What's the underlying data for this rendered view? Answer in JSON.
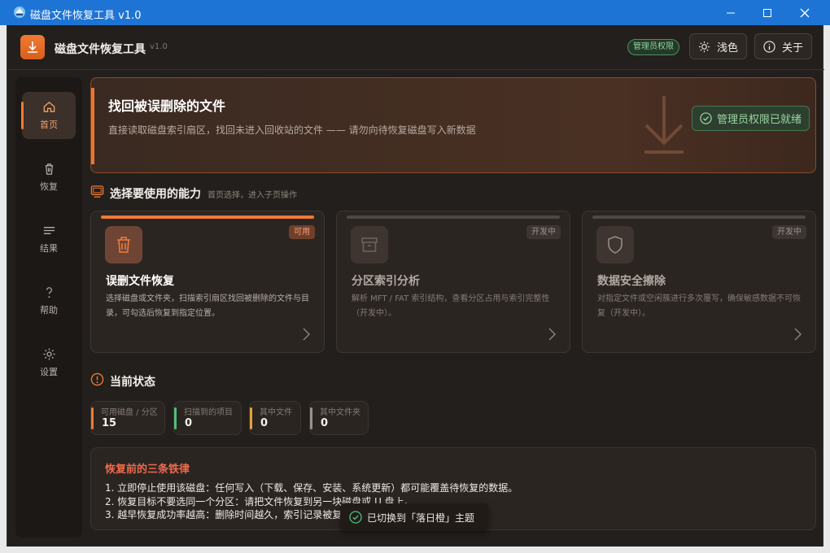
{
  "window": {
    "title": "磁盘文件恢复工具 v1.0"
  },
  "header": {
    "app_name": "磁盘文件恢复工具",
    "version": "v1.0",
    "admin_badge": "管理员权限",
    "theme_label": "浅色",
    "about_label": "关于"
  },
  "sidebar": {
    "items": [
      {
        "label": "首页",
        "icon": "home-icon",
        "active": true
      },
      {
        "label": "恢复",
        "icon": "trash-icon"
      },
      {
        "label": "结果",
        "icon": "list-icon"
      },
      {
        "label": "帮助",
        "icon": "help-icon"
      },
      {
        "label": "设置",
        "icon": "settings-icon"
      }
    ]
  },
  "hero": {
    "title": "找回被误删除的文件",
    "subtitle": "直接读取磁盘索引扇区，找回未进入回收站的文件 —— 请勿向待恢复磁盘写入新数据",
    "status": "管理员权限已就绪"
  },
  "capabilities": {
    "title": "选择要使用的能力",
    "hint": "首页选择，进入子页操作",
    "cards": [
      {
        "title": "误删文件恢复",
        "badge": "可用",
        "desc": "选择磁盘或文件夹，扫描索引扇区找回被删除的文件与目录，可勾选后恢复到指定位置。",
        "icon": "trash-icon"
      },
      {
        "title": "分区索引分析",
        "badge": "开发中",
        "desc": "解析 MFT / FAT 索引结构，查看分区占用与索引完整性（开发中）。",
        "icon": "archive-icon"
      },
      {
        "title": "数据安全擦除",
        "badge": "开发中",
        "desc": "对指定文件或空闲簇进行多次覆写，确保敏感数据不可恢复（开发中）。",
        "icon": "shield-icon"
      }
    ]
  },
  "status": {
    "title": "当前状态",
    "items": [
      {
        "label": "可用磁盘 / 分区",
        "value": "15",
        "color": "#ef7a35"
      },
      {
        "label": "扫描到的项目",
        "value": "0",
        "color": "#4ec07c"
      },
      {
        "label": "其中文件",
        "value": "0",
        "color": "#e3a13a"
      },
      {
        "label": "其中文件夹",
        "value": "0",
        "color": "#9b918a"
      }
    ]
  },
  "rules": {
    "title": "恢复前的三条铁律",
    "items": [
      "1. 立即停止使用该磁盘：任何写入（下载、保存、安装、系统更新）都可能覆盖待恢复的数据。",
      "2. 恢复目标不要选同一个分区：请把文件恢复到另一块磁盘或 U 盘上。",
      "3. 越早恢复成功率越高：删除时间越久，索引记录被复用的可能越大。"
    ]
  },
  "toast": {
    "message": "已切换到「落日橙」主题"
  },
  "colors": {
    "accent": "#ef7a35",
    "titlebar": "#1e74d4",
    "background": "#231f1c",
    "success": "#4ec07c"
  }
}
